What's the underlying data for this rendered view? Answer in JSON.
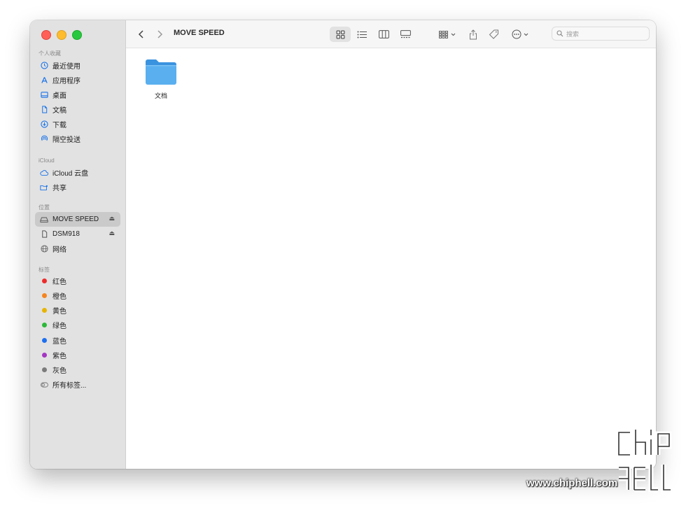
{
  "sidebar": {
    "sections": {
      "favorites": "个人收藏",
      "icloud": "iCloud",
      "locations": "位置",
      "tags": "标签"
    },
    "favorites": [
      {
        "label": "最近使用",
        "icon": "clock-icon"
      },
      {
        "label": "应用程序",
        "icon": "apps-icon"
      },
      {
        "label": "桌面",
        "icon": "desktop-icon"
      },
      {
        "label": "文稿",
        "icon": "document-icon"
      },
      {
        "label": "下载",
        "icon": "download-icon"
      },
      {
        "label": "隔空投送",
        "icon": "airdrop-icon"
      }
    ],
    "icloud": [
      {
        "label": "iCloud 云盘",
        "icon": "cloud-icon"
      },
      {
        "label": "共享",
        "icon": "shared-folder-icon"
      }
    ],
    "locations": [
      {
        "label": "MOVE SPEED",
        "icon": "drive-icon",
        "selected": true
      },
      {
        "label": "DSM918",
        "icon": "server-icon"
      },
      {
        "label": "网络",
        "icon": "network-icon"
      }
    ],
    "tags": [
      {
        "label": "红色",
        "color": "#ee2b2b"
      },
      {
        "label": "橙色",
        "color": "#f5841f"
      },
      {
        "label": "黄色",
        "color": "#e7b400"
      },
      {
        "label": "绿色",
        "color": "#2cb838"
      },
      {
        "label": "蓝色",
        "color": "#1d6ff0"
      },
      {
        "label": "紫色",
        "color": "#a437c2"
      },
      {
        "label": "灰色",
        "color": "#7b7b7b"
      },
      {
        "label": "所有标签...",
        "color": ""
      }
    ]
  },
  "toolbar": {
    "title": "MOVE SPEED",
    "search_placeholder": "搜索"
  },
  "content": {
    "items": [
      {
        "label": "文档",
        "icon": "folder-icon",
        "color": "#5aafef"
      }
    ]
  },
  "watermark": {
    "url": "www.chiphell.com"
  }
}
